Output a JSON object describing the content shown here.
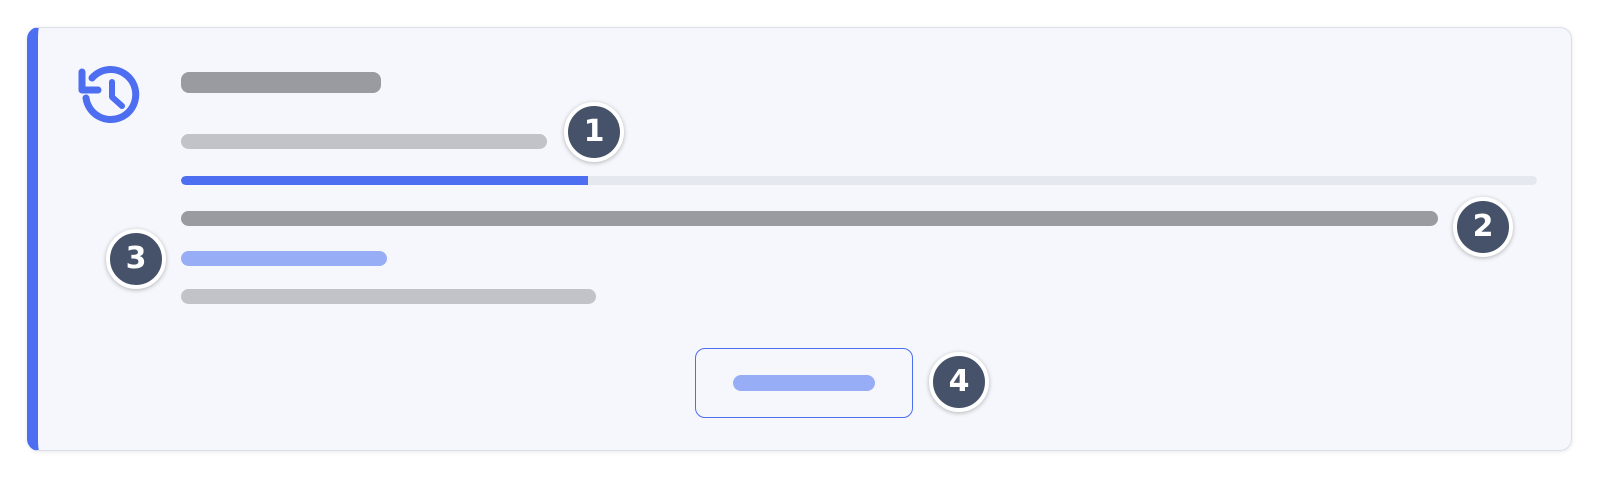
{
  "colors": {
    "accent": "#4d6ef0",
    "card_background": "#f6f7fc",
    "marker_background": "#45526a"
  },
  "card": {
    "icon": "history-icon",
    "progress": 0.3
  },
  "markers": [
    "1",
    "2",
    "3",
    "4"
  ]
}
